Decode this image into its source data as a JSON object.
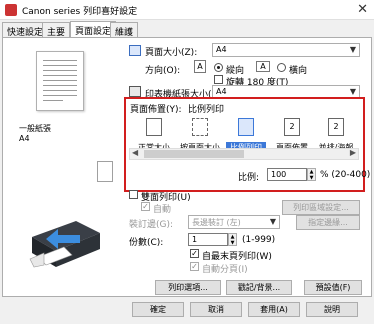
{
  "window": {
    "title": "Canon series 列印喜好設定",
    "close_glyph": "✕"
  },
  "tabs": [
    "快速設定",
    "主要",
    "頁面設定",
    "維護"
  ],
  "active_tab": 2,
  "preview": {
    "paper_label_line1": "一般紙張",
    "paper_label_line2": "A4"
  },
  "page_size": {
    "label": "頁面大小(Z):",
    "value": "A4"
  },
  "orientation": {
    "label": "方向(O):",
    "portrait": "縱向",
    "landscape": "橫向",
    "rotate": "旋轉 180 度(T)"
  },
  "printer_paper": {
    "label": "印表機紙張大小(E):",
    "value": "A4"
  },
  "page_layout": {
    "label": "頁面佈置(Y):",
    "current": "比例列印",
    "options": [
      "正常大小",
      "按頁面大小",
      "比例列印",
      "頁面佈置",
      "並排/海報"
    ],
    "selected_index": 2,
    "scale_label": "比例:",
    "scale_value": "100",
    "scale_range": "% (20-400)"
  },
  "duplex": {
    "label": "雙面列印(U)",
    "auto": "自動",
    "area_button": "列印區域設定...",
    "binding_label": "裝訂邊(G):",
    "binding_value": "長邊裝訂 (左)",
    "margin_button": "指定邊緣..."
  },
  "copies": {
    "label": "份數(C):",
    "value": "1",
    "range": "(1-999)",
    "reverse": "自最末頁列印(W)",
    "collate": "自動分頁(I)"
  },
  "actions": {
    "print_options": "列印選項...",
    "stamp": "戳記/背景...",
    "defaults": "預設值(F)"
  },
  "footer": {
    "ok": "確定",
    "cancel": "取消",
    "apply": "套用(A)",
    "help": "說明"
  }
}
